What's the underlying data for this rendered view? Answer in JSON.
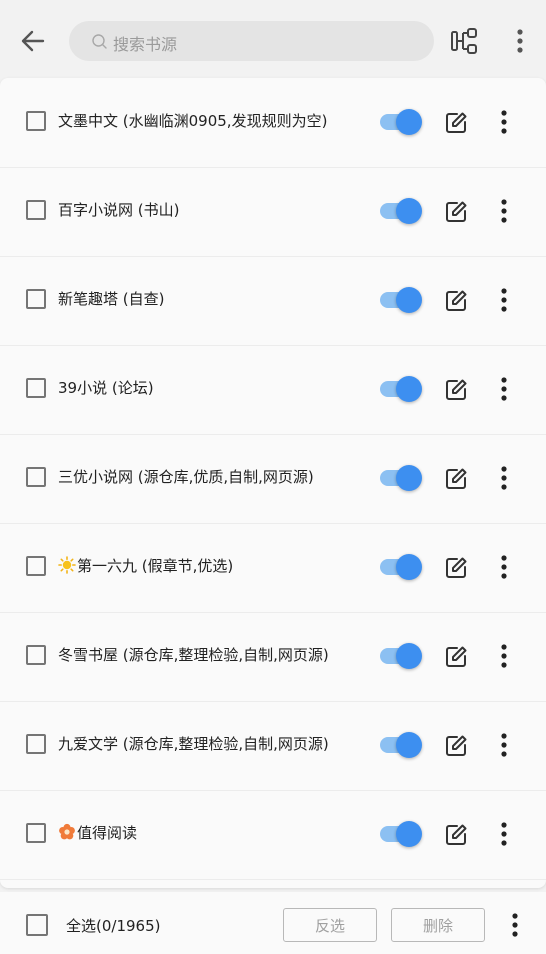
{
  "search": {
    "placeholder": "搜索书源"
  },
  "sources": [
    {
      "name": "文墨中文 (水幽临渊0905,发现规则为空)",
      "emoji": "",
      "enabled": true,
      "checked": false
    },
    {
      "name": "百字小说网 (书山)",
      "emoji": "",
      "enabled": true,
      "checked": false
    },
    {
      "name": "新笔趣塔 (自查)",
      "emoji": "",
      "enabled": true,
      "checked": false
    },
    {
      "name": "39小说 (论坛)",
      "emoji": "",
      "enabled": true,
      "checked": false
    },
    {
      "name": "三优小说网 (源仓库,优质,自制,网页源)",
      "emoji": "",
      "enabled": true,
      "checked": false
    },
    {
      "name": "第一六九 (假章节,优选)",
      "emoji": "sun-icon",
      "enabled": true,
      "checked": false
    },
    {
      "name": "冬雪书屋 (源仓库,整理检验,自制,网页源)",
      "emoji": "",
      "enabled": true,
      "checked": false
    },
    {
      "name": "九爱文学 (源仓库,整理检验,自制,网页源)",
      "emoji": "",
      "enabled": true,
      "checked": false
    },
    {
      "name": "值得阅读",
      "emoji": "flower-icon",
      "enabled": true,
      "checked": false
    }
  ],
  "bottom": {
    "select_all": "全选(0/1965)",
    "invert": "反选",
    "delete": "删除"
  },
  "colors": {
    "accent": "#3d8ff0",
    "track": "#8cc0f2"
  }
}
